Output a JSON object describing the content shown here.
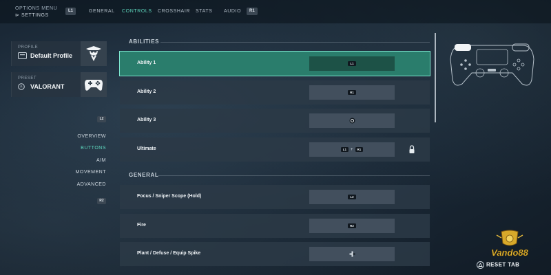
{
  "header": {
    "breadcrumb_top": "OPTIONS MENU",
    "breadcrumb_sub": "SETTINGS",
    "left_bumper": "L1",
    "right_bumper": "R1",
    "tabs": [
      "GENERAL",
      "CONTROLS",
      "CROSSHAIR",
      "STATS",
      "AUDIO"
    ],
    "active_tab": "CONTROLS"
  },
  "left_panel": {
    "profile_label": "PROFILE",
    "profile_value": "Default Profile",
    "preset_label": "PRESET",
    "preset_value": "VALORANT",
    "nav_up_key": "L2",
    "nav_down_key": "R2",
    "nav_items": [
      "OVERVIEW",
      "BUTTONS",
      "AIM",
      "MOVEMENT",
      "ADVANCED"
    ],
    "active_nav": "BUTTONS"
  },
  "sections": {
    "abilities_title": "ABILITIES",
    "general_title": "GENERAL"
  },
  "rows": [
    {
      "name": "Ability 1",
      "keys": [
        "L1"
      ],
      "selected": true
    },
    {
      "name": "Ability 2",
      "keys": [
        "R1"
      ]
    },
    {
      "name": "Ability 3",
      "keys": [
        "circle"
      ]
    },
    {
      "name": "Ultimate",
      "keys": [
        "L1",
        "+",
        "R1"
      ],
      "locked": true
    },
    {
      "name": "Focus / Sniper Scope (Hold)",
      "keys": [
        "L2"
      ]
    },
    {
      "name": "Fire",
      "keys": [
        "R2"
      ]
    },
    {
      "name": "Plant / Defuse / Equip Spike",
      "keys": [
        "dpad-right"
      ]
    }
  ],
  "footer": {
    "reset_label": "RESET TAB"
  },
  "watermark": {
    "text": "Vando88"
  },
  "colors": {
    "accent": "#5ed6bd",
    "selected_row": "#2a7d6c"
  }
}
